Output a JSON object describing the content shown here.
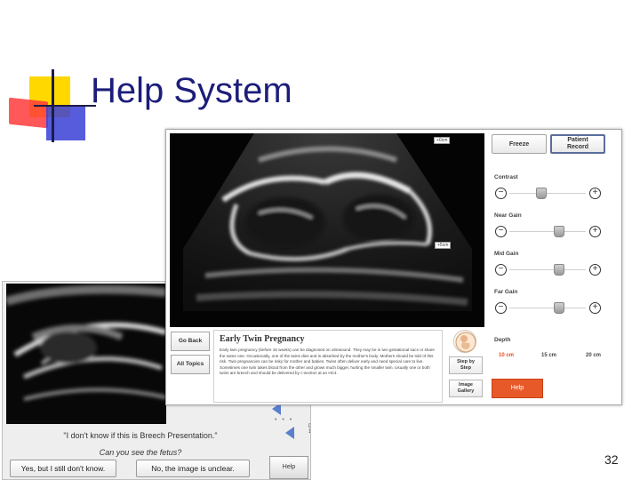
{
  "slide": {
    "title": "Help System",
    "page_number": "32"
  },
  "back_screen": {
    "question": "\"I don't know if this is Breech Presentation.\"",
    "prompt": "Can you see the fetus?",
    "answer_yes": "Yes, but I still don't know.",
    "answer_no": "No, the image is unclear.",
    "help_label": "Help",
    "d_label": "D\n1"
  },
  "app": {
    "markers": {
      "top": "+0cm",
      "mid": "+5cm"
    },
    "freeze_label": "Freeze",
    "patient_record_label": "Patient\nRecord",
    "controls": [
      {
        "label": "Contrast",
        "level": 0.4
      },
      {
        "label": "Near Gain",
        "level": 0.68
      },
      {
        "label": "Mid Gain",
        "level": 0.68
      },
      {
        "label": "Far Gain",
        "level": 0.68
      }
    ],
    "depth": {
      "label": "Depth",
      "options": [
        "10 cm",
        "15 cm",
        "20 cm"
      ],
      "selected": "10 cm"
    },
    "help_label": "Help",
    "nav": {
      "go_back": "Go Back",
      "all_topics": "All Topics"
    },
    "help_topic": {
      "title": "Early Twin Pregnancy",
      "body": "Early twin pregnancy (before 16 weeks) can be diagnosed on ultrasound. They may be in two gestational sacs or share the same one. Occasionally, one of the twins dies and is absorbed by the mother's body. Mothers should be told of this risk. Twin pregnancies can be risky for mother and babies. Twins often deliver early and need special care to live. Sometimes one twin takes blood from the other and grows much bigger, hurting the smaller twin. Usually one or both twins are breech and should be delivered by c-section at an HC4."
    },
    "side": {
      "step_by_step": "Step by\nStep",
      "image_gallery": "Image\nGallery"
    },
    "colors": {
      "accent": "#e8592a",
      "depth_active": "#e94b1b"
    }
  }
}
